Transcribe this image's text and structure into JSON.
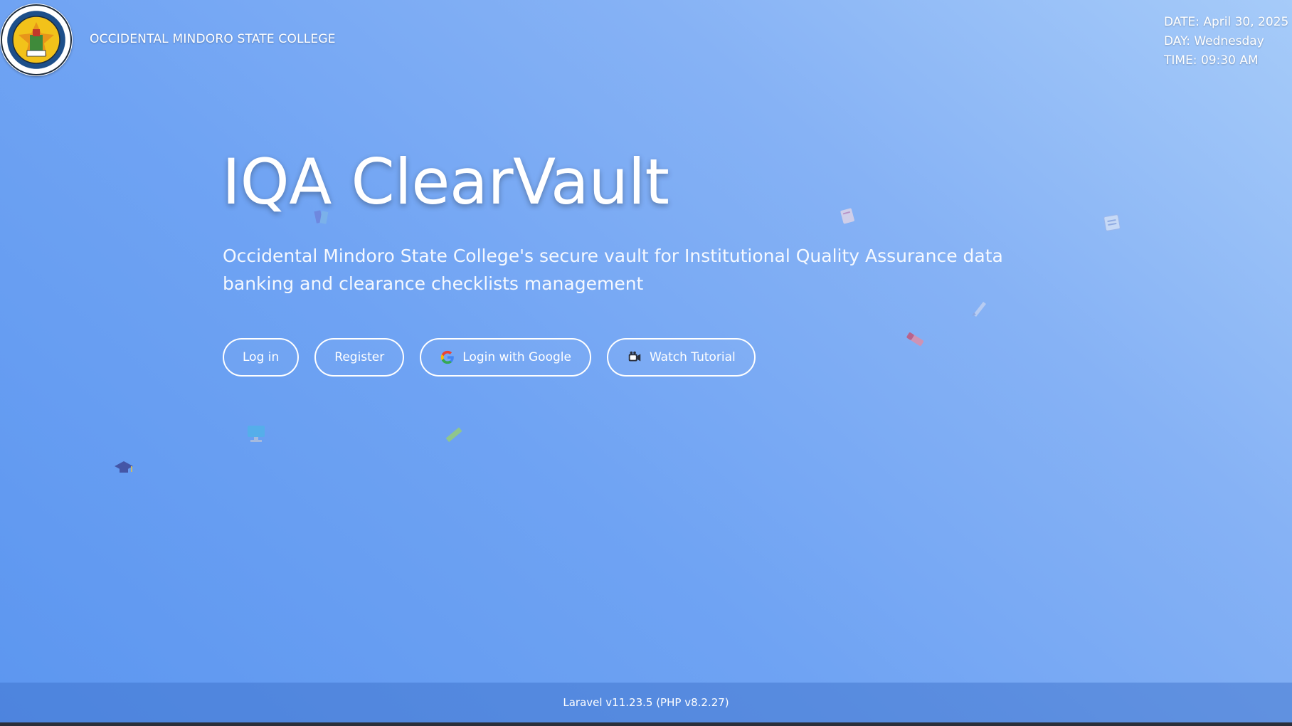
{
  "header": {
    "college_name": "OCCIDENTAL MINDORO STATE COLLEGE",
    "seal_text": "OCCIDENTAL MINDORO STATE COLLEGE"
  },
  "datetime": {
    "date": "DATE: April 30, 2025",
    "day": "DAY: Wednesday",
    "time": "TIME: 09:30 AM"
  },
  "hero": {
    "title": "IQA ClearVault",
    "description": "Occidental Mindoro State College's secure vault for Institutional Quality Assurance data banking and clearance checklists management"
  },
  "actions": {
    "login_label": "Log in",
    "register_label": "Register",
    "google_label": "Login with Google",
    "tutorial_label": "Watch Tutorial"
  },
  "footer": {
    "version": "Laravel v11.23.5 (PHP v8.2.27)"
  },
  "colors": {
    "background_start": "#a6cbf9",
    "background_end": "#5c96f0",
    "text": "#ffffff"
  },
  "icons": {
    "floating": [
      "book-icon",
      "clipboard-icon",
      "document-icon",
      "pen-icon",
      "eraser-icon",
      "monitor-icon",
      "ruler-icon",
      "graduation-cap-icon"
    ]
  }
}
